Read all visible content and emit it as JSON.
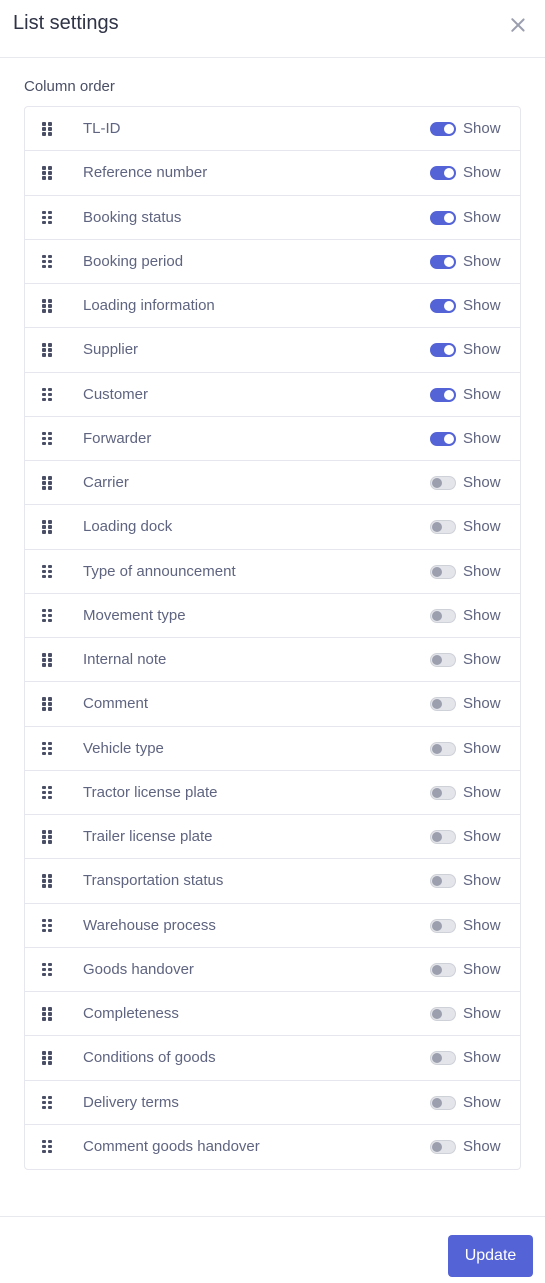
{
  "dialog": {
    "title": "List settings"
  },
  "section": {
    "label": "Column order"
  },
  "show_label": "Show",
  "accent_color": "#5463d6",
  "columns": [
    {
      "label": "TL-ID",
      "show": true
    },
    {
      "label": "Reference number",
      "show": true
    },
    {
      "label": "Booking status",
      "show": true
    },
    {
      "label": "Booking period",
      "show": true
    },
    {
      "label": "Loading information",
      "show": true
    },
    {
      "label": "Supplier",
      "show": true
    },
    {
      "label": "Customer",
      "show": true
    },
    {
      "label": "Forwarder",
      "show": true
    },
    {
      "label": "Carrier",
      "show": false
    },
    {
      "label": "Loading dock",
      "show": false
    },
    {
      "label": "Type of announcement",
      "show": false
    },
    {
      "label": "Movement type",
      "show": false
    },
    {
      "label": "Internal note",
      "show": false
    },
    {
      "label": "Comment",
      "show": false
    },
    {
      "label": "Vehicle type",
      "show": false
    },
    {
      "label": "Tractor license plate",
      "show": false
    },
    {
      "label": "Trailer license plate",
      "show": false
    },
    {
      "label": "Transportation status",
      "show": false
    },
    {
      "label": "Warehouse process",
      "show": false
    },
    {
      "label": "Goods handover",
      "show": false
    },
    {
      "label": "Completeness",
      "show": false
    },
    {
      "label": "Conditions of goods",
      "show": false
    },
    {
      "label": "Delivery terms",
      "show": false
    },
    {
      "label": "Comment goods handover",
      "show": false
    }
  ],
  "footer": {
    "update_label": "Update"
  }
}
